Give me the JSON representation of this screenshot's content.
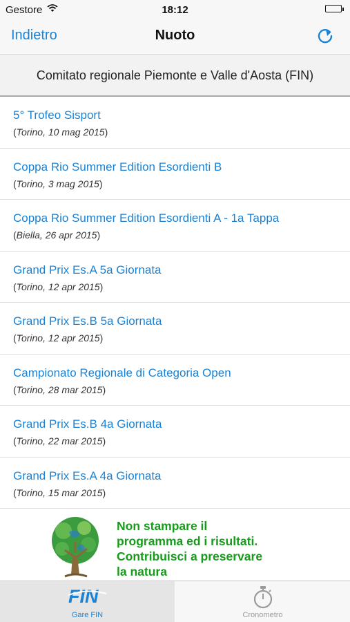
{
  "status_bar": {
    "carrier": "Gestore",
    "time": "18:12"
  },
  "nav": {
    "back_label": "Indietro",
    "title": "Nuoto"
  },
  "header": {
    "text": "Comitato regionale Piemonte e Valle d'Aosta (FIN)"
  },
  "events": [
    {
      "name": "5° Trofeo Sisport",
      "place": "Torino",
      "date": "10 mag 2015"
    },
    {
      "name": "Coppa Rio Summer Edition Esordienti B",
      "place": "Torino",
      "date": "3 mag 2015"
    },
    {
      "name": "Coppa Rio Summer Edition Esordienti A - 1a Tappa",
      "place": "Biella",
      "date": "26 apr 2015"
    },
    {
      "name": "Grand Prix Es.A 5a Giornata",
      "place": "Torino",
      "date": "12 apr 2015"
    },
    {
      "name": "Grand Prix Es.B 5a Giornata",
      "place": "Torino",
      "date": "12 apr 2015"
    },
    {
      "name": "Campionato Regionale di Categoria Open",
      "place": "Torino",
      "date": "28 mar 2015"
    },
    {
      "name": "Grand Prix Es.B 4a Giornata",
      "place": "Torino",
      "date": "22 mar 2015"
    },
    {
      "name": "Grand Prix Es.A 4a Giornata",
      "place": "Torino",
      "date": "15 mar 2015"
    }
  ],
  "banner": {
    "lines": [
      "Non stampare il",
      "programma ed i risultati.",
      "Contribuisci a preservare",
      "la natura"
    ],
    "icon": "tree-globe-icon"
  },
  "tabs": [
    {
      "label": "Gare FIN",
      "icon": "fin-logo-icon",
      "selected": true
    },
    {
      "label": "Cronometro",
      "icon": "stopwatch-icon",
      "selected": false
    }
  ],
  "colors": {
    "accent": "#1a83d6",
    "banner_text": "#169b1b",
    "inactive": "#9a9a9a"
  }
}
